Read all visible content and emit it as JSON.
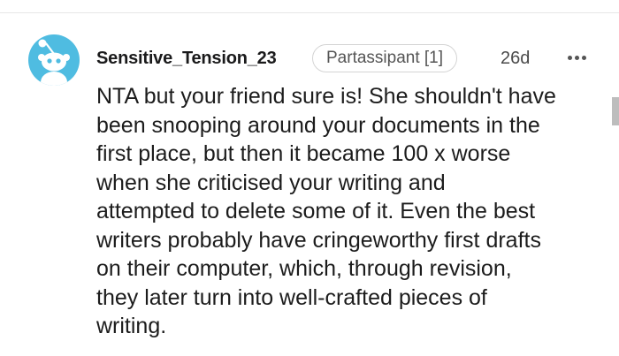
{
  "comment": {
    "author": "Sensitive_Tension_23",
    "flair": "Partassipant [1]",
    "age": "26d",
    "lines": [
      "NTA but your friend sure is! She shouldn't have",
      "been snooping around your documents in the",
      "first place, but then it became 100 x worse",
      "when she criticised your writing and",
      "attempted to delete some of it. Even the best",
      "writers probably have cringeworthy first drafts",
      "on their computer, which, through revision,",
      "they later turn into well-crafted pieces of",
      "writing."
    ]
  },
  "icons": {
    "avatar": "snoo-avatar-icon",
    "more": "more-options-icon"
  },
  "colors": {
    "avatar_background": "#4fbce1",
    "text": "#1c1c1c",
    "muted": "#555555"
  }
}
